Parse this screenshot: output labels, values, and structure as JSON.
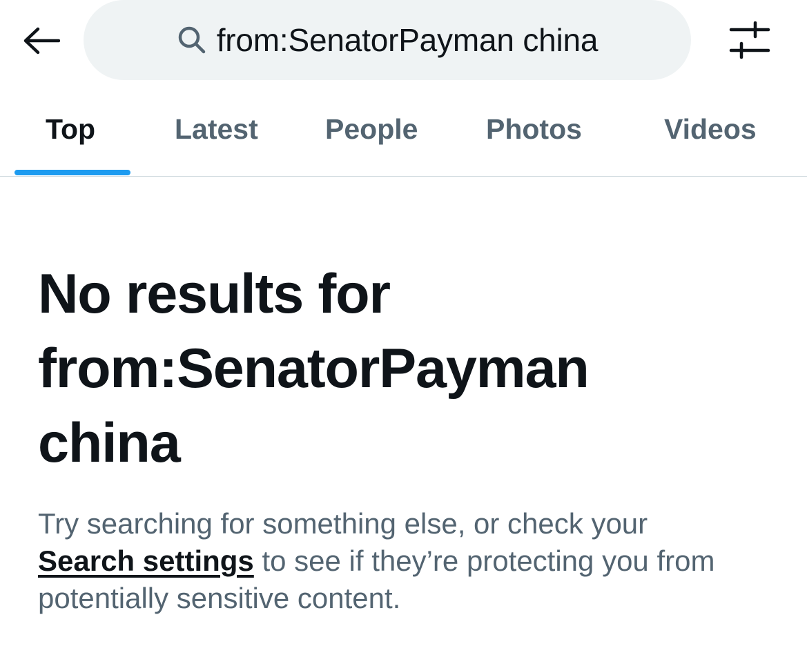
{
  "header": {
    "back_icon": "back-arrow-icon",
    "search": {
      "icon": "search-icon",
      "value": "from:SenatorPayman china"
    },
    "filter_icon": "search-filters-icon"
  },
  "tabs": [
    {
      "label": "Top",
      "active": true
    },
    {
      "label": "Latest",
      "active": false
    },
    {
      "label": "People",
      "active": false
    },
    {
      "label": "Photos",
      "active": false
    },
    {
      "label": "Videos",
      "active": false
    }
  ],
  "empty_state": {
    "title_prefix": "No results for",
    "title_query_line1": "from:SenatorPayman",
    "title_query_line2": "china",
    "description_before": "Try searching for something else, or check your ",
    "settings_link": "Search settings",
    "description_after": " to see if they’re protecting you from potentially sensitive content."
  },
  "colors": {
    "accent": "#1d9bf0",
    "primary_text": "#0f1419",
    "secondary_text": "#536471",
    "search_bg": "#eff3f4",
    "divider": "#cfd9de"
  }
}
